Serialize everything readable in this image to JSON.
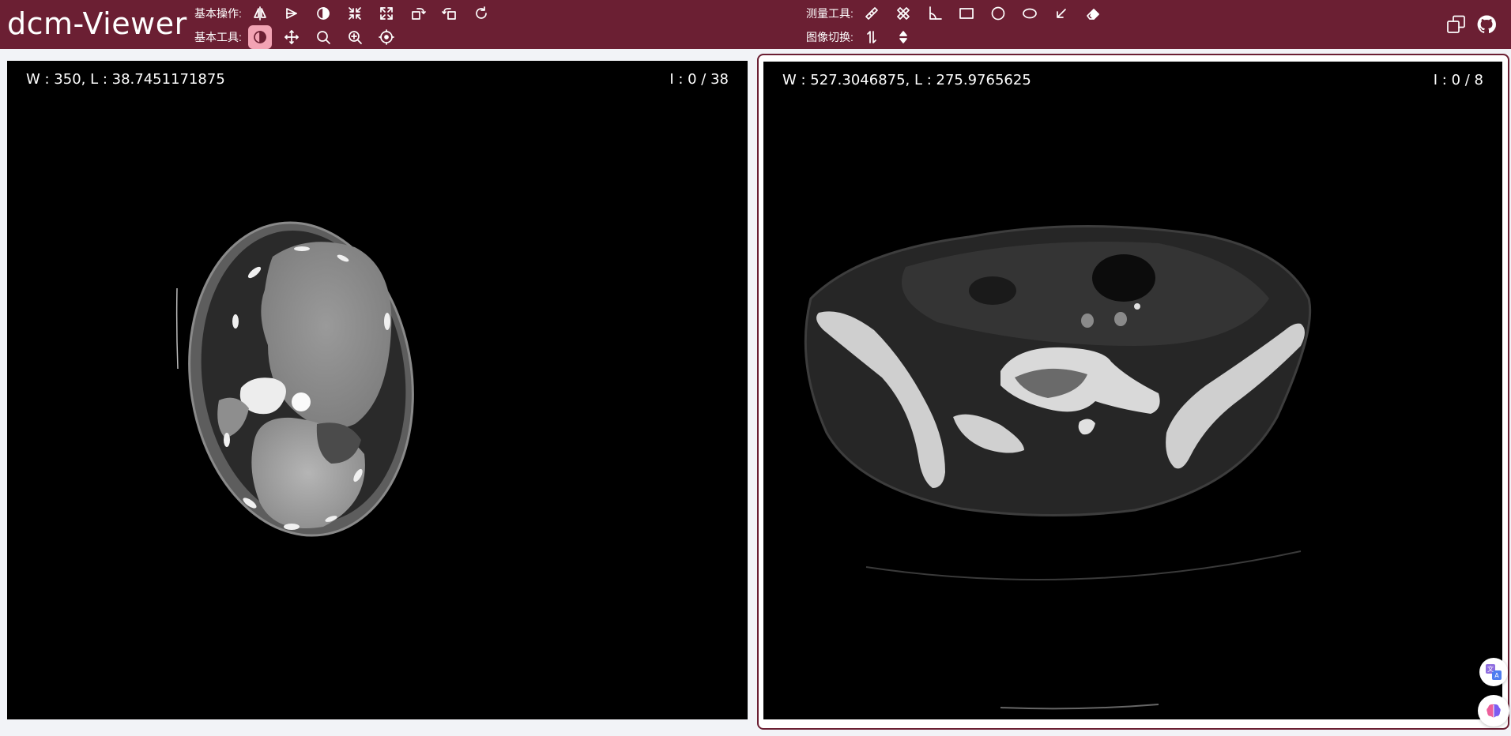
{
  "app": {
    "title": "dcm-Viewer"
  },
  "toolbar": {
    "basic_ops": {
      "label": "基本操作:",
      "items": [
        "flip-horizontal-icon",
        "flip-vertical-icon",
        "invert-icon",
        "fit-icon",
        "fullscreen-icon",
        "rotate-right-icon",
        "rotate-left-icon",
        "reset-icon"
      ]
    },
    "basic_tools": {
      "label": "基本工具:",
      "items": [
        "window-level-icon",
        "pan-icon",
        "zoom-icon",
        "magnify-icon",
        "probe-icon"
      ],
      "active": "window-level-icon"
    },
    "measure_tools": {
      "label": "测量工具:",
      "items": [
        "ruler-icon",
        "bidirectional-ruler-icon",
        "angle-icon",
        "rectangle-roi-icon",
        "circle-roi-icon",
        "ellipse-roi-icon",
        "arrow-annotate-icon",
        "eraser-icon"
      ]
    },
    "image_switch": {
      "label": "图像切换:",
      "items": [
        "stack-scroll-icon",
        "prev-next-icon"
      ]
    }
  },
  "header_actions": [
    "layout-icon",
    "github-icon"
  ],
  "viewports": [
    {
      "name": "viewport-left",
      "window_level": "W : 350, L : 38.7451171875",
      "index": "I : 0 / 38"
    },
    {
      "name": "viewport-right",
      "window_level": "W : 527.3046875, L : 275.9765625",
      "index": "I : 0 / 8",
      "selected": true
    }
  ],
  "floating": [
    "translate-icon",
    "ai-brain-icon"
  ],
  "colors": {
    "header_bg": "#6b1f33",
    "active_tool": "#f2a3b4",
    "page_bg": "#f2f3f7"
  }
}
